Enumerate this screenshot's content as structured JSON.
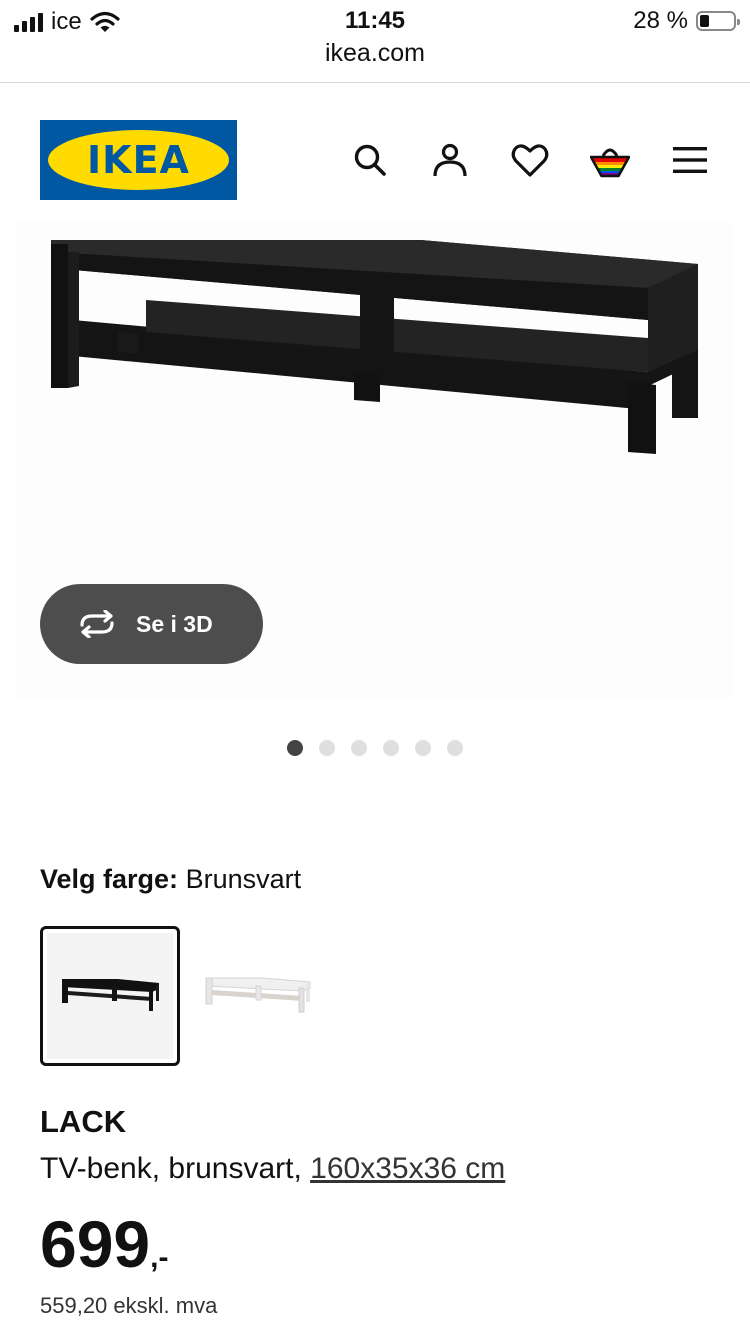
{
  "status_bar": {
    "carrier": "ice",
    "time": "11:45",
    "url": "ikea.com",
    "battery_text": "28 %",
    "battery_level": 0.28
  },
  "header": {
    "logo_text": "IKEA",
    "icons": [
      "search-icon",
      "account-icon",
      "heart-icon",
      "basket-icon",
      "menu-icon"
    ]
  },
  "gallery": {
    "view_3d_label": "Se i 3D",
    "image_count": 6,
    "active_index": 0
  },
  "product": {
    "color_label": "Velg farge:",
    "color_value": "Brunsvart",
    "color_options": [
      "Brunsvart",
      "Hvit"
    ],
    "name": "LACK",
    "description": "TV-benk, brunsvart,",
    "dimensions": "160x35x36 cm",
    "price": "699",
    "price_suffix": ",-",
    "price_ex_vat": "559,20 ekskl. mva"
  },
  "colors": {
    "ikea_blue": "#0058a3",
    "ikea_yellow": "#ffdb00",
    "button_dark": "#4d4d4d",
    "furniture_dark": "#222222"
  }
}
